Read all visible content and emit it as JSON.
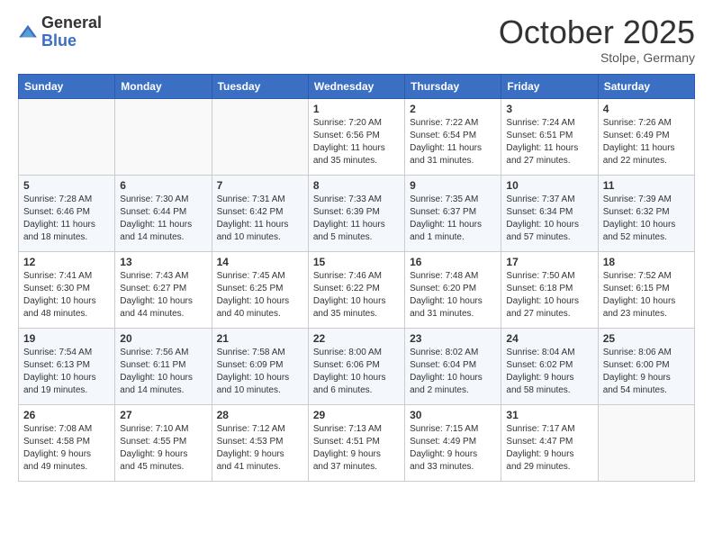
{
  "logo": {
    "general": "General",
    "blue": "Blue"
  },
  "header": {
    "month": "October 2025",
    "location": "Stolpe, Germany"
  },
  "weekdays": [
    "Sunday",
    "Monday",
    "Tuesday",
    "Wednesday",
    "Thursday",
    "Friday",
    "Saturday"
  ],
  "weeks": [
    [
      {
        "day": "",
        "info": ""
      },
      {
        "day": "",
        "info": ""
      },
      {
        "day": "",
        "info": ""
      },
      {
        "day": "1",
        "info": "Sunrise: 7:20 AM\nSunset: 6:56 PM\nDaylight: 11 hours\nand 35 minutes."
      },
      {
        "day": "2",
        "info": "Sunrise: 7:22 AM\nSunset: 6:54 PM\nDaylight: 11 hours\nand 31 minutes."
      },
      {
        "day": "3",
        "info": "Sunrise: 7:24 AM\nSunset: 6:51 PM\nDaylight: 11 hours\nand 27 minutes."
      },
      {
        "day": "4",
        "info": "Sunrise: 7:26 AM\nSunset: 6:49 PM\nDaylight: 11 hours\nand 22 minutes."
      }
    ],
    [
      {
        "day": "5",
        "info": "Sunrise: 7:28 AM\nSunset: 6:46 PM\nDaylight: 11 hours\nand 18 minutes."
      },
      {
        "day": "6",
        "info": "Sunrise: 7:30 AM\nSunset: 6:44 PM\nDaylight: 11 hours\nand 14 minutes."
      },
      {
        "day": "7",
        "info": "Sunrise: 7:31 AM\nSunset: 6:42 PM\nDaylight: 11 hours\nand 10 minutes."
      },
      {
        "day": "8",
        "info": "Sunrise: 7:33 AM\nSunset: 6:39 PM\nDaylight: 11 hours\nand 5 minutes."
      },
      {
        "day": "9",
        "info": "Sunrise: 7:35 AM\nSunset: 6:37 PM\nDaylight: 11 hours\nand 1 minute."
      },
      {
        "day": "10",
        "info": "Sunrise: 7:37 AM\nSunset: 6:34 PM\nDaylight: 10 hours\nand 57 minutes."
      },
      {
        "day": "11",
        "info": "Sunrise: 7:39 AM\nSunset: 6:32 PM\nDaylight: 10 hours\nand 52 minutes."
      }
    ],
    [
      {
        "day": "12",
        "info": "Sunrise: 7:41 AM\nSunset: 6:30 PM\nDaylight: 10 hours\nand 48 minutes."
      },
      {
        "day": "13",
        "info": "Sunrise: 7:43 AM\nSunset: 6:27 PM\nDaylight: 10 hours\nand 44 minutes."
      },
      {
        "day": "14",
        "info": "Sunrise: 7:45 AM\nSunset: 6:25 PM\nDaylight: 10 hours\nand 40 minutes."
      },
      {
        "day": "15",
        "info": "Sunrise: 7:46 AM\nSunset: 6:22 PM\nDaylight: 10 hours\nand 35 minutes."
      },
      {
        "day": "16",
        "info": "Sunrise: 7:48 AM\nSunset: 6:20 PM\nDaylight: 10 hours\nand 31 minutes."
      },
      {
        "day": "17",
        "info": "Sunrise: 7:50 AM\nSunset: 6:18 PM\nDaylight: 10 hours\nand 27 minutes."
      },
      {
        "day": "18",
        "info": "Sunrise: 7:52 AM\nSunset: 6:15 PM\nDaylight: 10 hours\nand 23 minutes."
      }
    ],
    [
      {
        "day": "19",
        "info": "Sunrise: 7:54 AM\nSunset: 6:13 PM\nDaylight: 10 hours\nand 19 minutes."
      },
      {
        "day": "20",
        "info": "Sunrise: 7:56 AM\nSunset: 6:11 PM\nDaylight: 10 hours\nand 14 minutes."
      },
      {
        "day": "21",
        "info": "Sunrise: 7:58 AM\nSunset: 6:09 PM\nDaylight: 10 hours\nand 10 minutes."
      },
      {
        "day": "22",
        "info": "Sunrise: 8:00 AM\nSunset: 6:06 PM\nDaylight: 10 hours\nand 6 minutes."
      },
      {
        "day": "23",
        "info": "Sunrise: 8:02 AM\nSunset: 6:04 PM\nDaylight: 10 hours\nand 2 minutes."
      },
      {
        "day": "24",
        "info": "Sunrise: 8:04 AM\nSunset: 6:02 PM\nDaylight: 9 hours\nand 58 minutes."
      },
      {
        "day": "25",
        "info": "Sunrise: 8:06 AM\nSunset: 6:00 PM\nDaylight: 9 hours\nand 54 minutes."
      }
    ],
    [
      {
        "day": "26",
        "info": "Sunrise: 7:08 AM\nSunset: 4:58 PM\nDaylight: 9 hours\nand 49 minutes."
      },
      {
        "day": "27",
        "info": "Sunrise: 7:10 AM\nSunset: 4:55 PM\nDaylight: 9 hours\nand 45 minutes."
      },
      {
        "day": "28",
        "info": "Sunrise: 7:12 AM\nSunset: 4:53 PM\nDaylight: 9 hours\nand 41 minutes."
      },
      {
        "day": "29",
        "info": "Sunrise: 7:13 AM\nSunset: 4:51 PM\nDaylight: 9 hours\nand 37 minutes."
      },
      {
        "day": "30",
        "info": "Sunrise: 7:15 AM\nSunset: 4:49 PM\nDaylight: 9 hours\nand 33 minutes."
      },
      {
        "day": "31",
        "info": "Sunrise: 7:17 AM\nSunset: 4:47 PM\nDaylight: 9 hours\nand 29 minutes."
      },
      {
        "day": "",
        "info": ""
      }
    ]
  ]
}
